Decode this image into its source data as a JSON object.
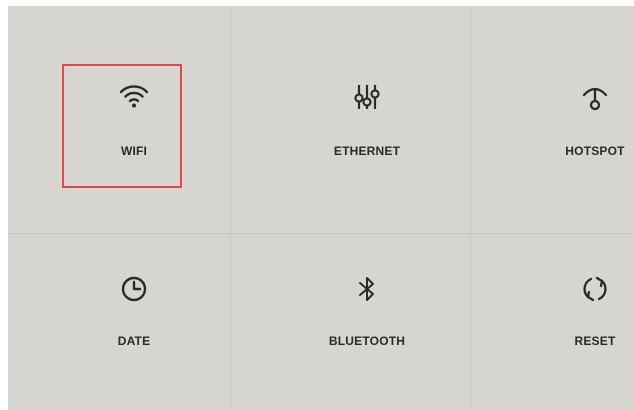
{
  "settings": {
    "tiles": [
      {
        "label": "WIFI",
        "icon": "wifi-icon",
        "selected": true
      },
      {
        "label": "ETHERNET",
        "icon": "ethernet-icon",
        "selected": false
      },
      {
        "label": "HOTSPOT",
        "icon": "hotspot-icon",
        "selected": false
      },
      {
        "label": "DATE",
        "icon": "clock-icon",
        "selected": false
      },
      {
        "label": "BLUETOOTH",
        "icon": "bluetooth-icon",
        "selected": false
      },
      {
        "label": "RESET",
        "icon": "refresh-icon",
        "selected": false
      }
    ]
  },
  "colors": {
    "background": "#d7d5cf",
    "grid_line": "#c9c6bf",
    "icon": "#2a2a2a",
    "selection": "#e2474b"
  }
}
